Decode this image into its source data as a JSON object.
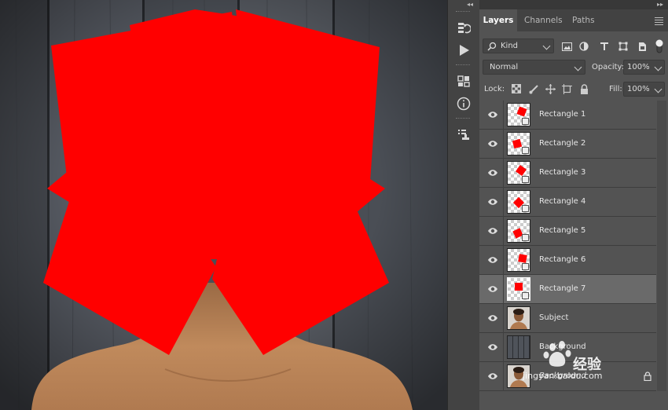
{
  "panel_tabs": [
    "Layers",
    "Channels",
    "Paths"
  ],
  "filter": {
    "kind_label": "Kind"
  },
  "blend": {
    "mode": "Normal",
    "opacity_label": "Opacity:",
    "opacity_value": "100%"
  },
  "lock": {
    "label": "Lock:",
    "fill_label": "Fill:",
    "fill_value": "100%"
  },
  "layers": [
    {
      "name": "Rectangle 1",
      "type": "shape",
      "selected": false
    },
    {
      "name": "Rectangle 2",
      "type": "shape",
      "selected": false
    },
    {
      "name": "Rectangle 3",
      "type": "shape",
      "selected": false
    },
    {
      "name": "Rectangle 4",
      "type": "shape",
      "selected": false
    },
    {
      "name": "Rectangle 5",
      "type": "shape",
      "selected": false
    },
    {
      "name": "Rectangle 6",
      "type": "shape",
      "selected": false
    },
    {
      "name": "Rectangle 7",
      "type": "shape",
      "selected": true
    },
    {
      "name": "Subject",
      "type": "photo",
      "selected": false
    },
    {
      "name": "Background",
      "type": "wood",
      "selected": false
    },
    {
      "name": "Background",
      "type": "photo",
      "selected": false,
      "locked": true
    }
  ],
  "watermark": {
    "text_cn": "经验",
    "url": "jingyan.baidu.com"
  },
  "colors": {
    "shape_red": "#ff0000",
    "panel_bg": "#535353",
    "selected_row": "#6a6a6a"
  }
}
